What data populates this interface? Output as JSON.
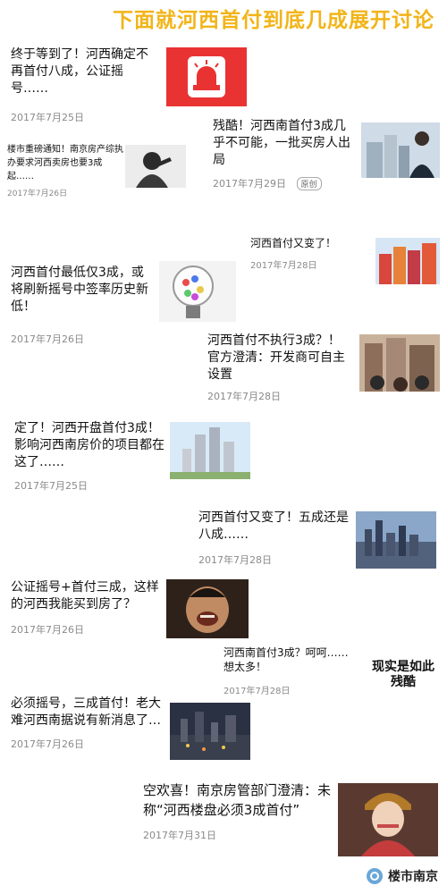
{
  "header": {
    "title": "下面就河西首付到底几成展开讨论"
  },
  "items": [
    {
      "title": "终于等到了！河西确定不再首付八成，公证摇号……",
      "date": "2017年7月25日",
      "thumb": "security-alarm-icon"
    },
    {
      "title": "残酷！河西南首付3成几乎不可能，一批买房人出局",
      "date": "2017年7月29日",
      "tag": "原创",
      "thumb": "businessman-building-photo"
    },
    {
      "title": "楼市重磅通知！南京房产综执办要求河西卖房也要3成起……",
      "date": "2017年7月26日",
      "thumb": "worried-man-photo"
    },
    {
      "title": "河西首付又变了！",
      "date": "2017年7月28日",
      "thumb": "colorful-buildings-photo"
    },
    {
      "title": "河西首付最低仅3成，或将刷新摇号中签率历史新低！",
      "date": "2017年7月26日",
      "thumb": "lottery-machine-photo"
    },
    {
      "title": "河西首付不执行3成？！官方澄清：开发商可自主设置",
      "date": "2017年7月28日",
      "thumb": "crowd-buildings-photo"
    },
    {
      "title": "定了！河西开盘首付3成！ 影响河西南房价的项目都在这了……",
      "date": "2017年7月25日",
      "thumb": "towers-sky-photo"
    },
    {
      "title": "河西首付又变了！五成还是八成……",
      "date": "2017年7月28日",
      "thumb": "city-skyline-photo"
    },
    {
      "title": "公证摇号+首付三成，这样的河西我能买到房了？",
      "date": "2017年7月26日",
      "thumb": "laughing-man-photo"
    },
    {
      "title": "河西南首付3成？呵呵……想太多！",
      "date": "2017年7月28日",
      "thumb": "meme-text-image",
      "meme_text": "现实是如此残酷"
    },
    {
      "title": "必须摇号，三成首付！老大难河西南据说有新消息了…",
      "date": "2017年7月26日",
      "thumb": "night-city-photo"
    },
    {
      "title": "空欢喜！南京房管部门澄清：未称“河西楼盘必须3成首付”",
      "date": "2017年7月31日",
      "thumb": "costume-actress-photo"
    }
  ],
  "watermark": {
    "text": "楼市南京"
  }
}
